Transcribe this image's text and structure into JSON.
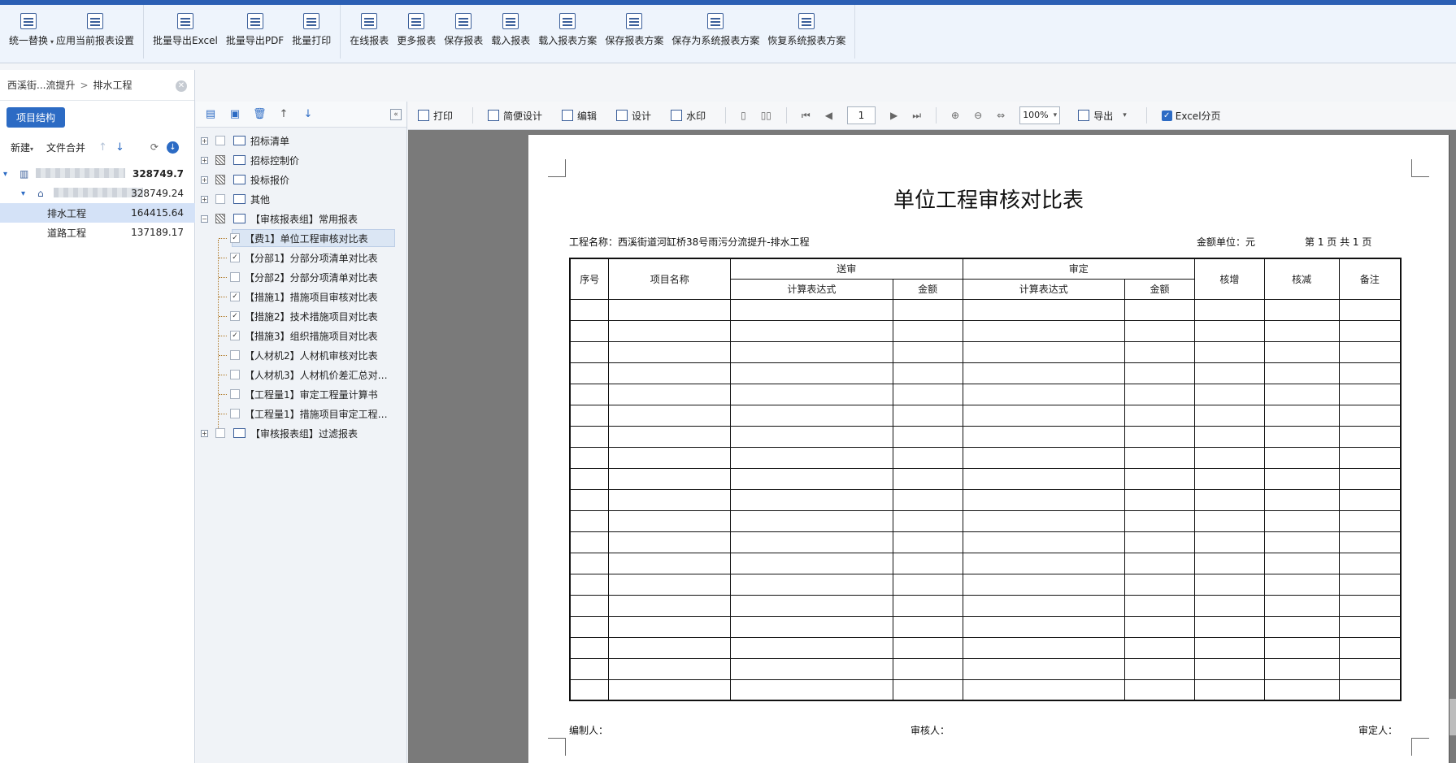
{
  "ribbon": {
    "groups": [
      [
        {
          "label": "统一替换",
          "dropdown": true
        },
        {
          "label": "应用当前报表设置"
        }
      ],
      [
        {
          "label": "批量导出Excel"
        },
        {
          "label": "批量导出PDF"
        },
        {
          "label": "批量打印"
        }
      ],
      [
        {
          "label": "在线报表"
        },
        {
          "label": "更多报表"
        },
        {
          "label": "保存报表"
        },
        {
          "label": "载入报表"
        },
        {
          "label": "载入报表方案"
        },
        {
          "label": "保存报表方案"
        },
        {
          "label": "保存为系统报表方案"
        },
        {
          "label": "恢复系统报表方案"
        }
      ]
    ]
  },
  "left": {
    "breadcrumb": [
      "西溪街...流提升",
      "排水工程"
    ],
    "breadcrumb_sep": ">",
    "project_button": "项目结构",
    "toolbar": {
      "new": "新建",
      "merge": "文件合并"
    },
    "tree": [
      {
        "name": "",
        "value": "328749.7",
        "blurred": true,
        "level": 0
      },
      {
        "name": "",
        "value": "328749.24",
        "blurred": true,
        "level": 1
      },
      {
        "name": "排水工程",
        "value": "164415.64",
        "level": 2,
        "selected": true
      },
      {
        "name": "道路工程",
        "value": "137189.17",
        "level": 2
      }
    ]
  },
  "reports": {
    "items": [
      {
        "label": "招标清单",
        "type": "group",
        "check": "none"
      },
      {
        "label": "招标控制价",
        "type": "group",
        "check": "partial"
      },
      {
        "label": "投标报价",
        "type": "group",
        "check": "partial"
      },
      {
        "label": "其他",
        "type": "group",
        "check": "none"
      },
      {
        "label": "【审核报表组】常用报表",
        "type": "group",
        "check": "partial",
        "expanded": true
      },
      {
        "label": "【费1】单位工程审核对比表",
        "type": "item",
        "check": "checked",
        "selected": true
      },
      {
        "label": "【分部1】分部分项清单对比表",
        "type": "item",
        "check": "checked"
      },
      {
        "label": "【分部2】分部分项清单对比表",
        "type": "item",
        "check": "none"
      },
      {
        "label": "【措施1】措施项目审核对比表",
        "type": "item",
        "check": "checked"
      },
      {
        "label": "【措施2】技术措施项目对比表",
        "type": "item",
        "check": "checked"
      },
      {
        "label": "【措施3】组织措施项目对比表",
        "type": "item",
        "check": "checked"
      },
      {
        "label": "【人材机2】人材机审核对比表",
        "type": "item",
        "check": "none"
      },
      {
        "label": "【人材机3】人材机价差汇总对…",
        "type": "item",
        "check": "none"
      },
      {
        "label": "【工程量1】审定工程量计算书",
        "type": "item",
        "check": "none"
      },
      {
        "label": "【工程量1】措施项目审定工程…",
        "type": "item",
        "check": "none"
      },
      {
        "label": "【审核报表组】过滤报表",
        "type": "group",
        "check": "none"
      }
    ]
  },
  "viewer": {
    "toolbar": {
      "print": "打印",
      "simple_design": "简便设计",
      "edit": "编辑",
      "design": "设计",
      "watermark": "水印",
      "page": "1",
      "zoom": "100%",
      "export": "导出",
      "excel_paging": "Excel分页",
      "excel_paging_checked": true
    },
    "document": {
      "title": "单位工程审核对比表",
      "project_name": "工程名称：西溪街道河缸桥38号雨污分流提升-排水工程",
      "unit": "金额单位：元",
      "page_info": "第 1 页 共 1 页",
      "headers": {
        "seq": "序号",
        "item": "项目名称",
        "submitted": "送审",
        "approved": "审定",
        "formula1": "计算表达式",
        "amount1": "金额",
        "formula2": "计算表达式",
        "amount2": "金额",
        "increase": "核增",
        "decrease": "核减",
        "remark": "备注"
      },
      "empty_rows": 19,
      "footer": {
        "preparer": "编制人：",
        "reviewer": "审核人：",
        "approver": "审定人："
      }
    }
  }
}
